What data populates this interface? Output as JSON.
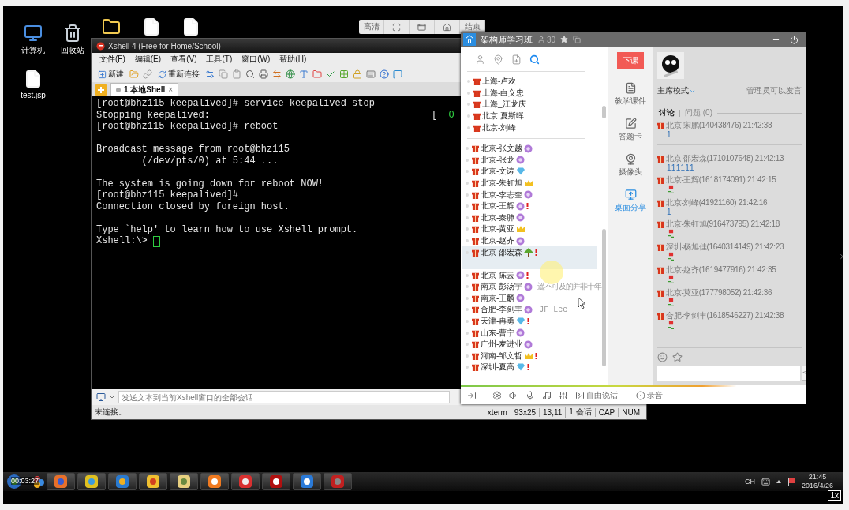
{
  "desktop": {
    "icons": [
      {
        "kind": "computer",
        "label": "计算机"
      },
      {
        "kind": "trash",
        "label": "回收站"
      },
      {
        "kind": "folder"
      },
      {
        "kind": "file"
      },
      {
        "kind": "file"
      },
      {
        "kind": "file",
        "label": "test.jsp"
      }
    ]
  },
  "floating_toolbar": {
    "items": [
      {
        "kind": "text",
        "label": "高清"
      },
      {
        "kind": "select"
      },
      {
        "kind": "window"
      },
      {
        "kind": "home"
      },
      {
        "kind": "text",
        "label": "结束"
      }
    ]
  },
  "xshell": {
    "title": "Xshell 4 (Free for Home/School)",
    "menu": [
      "文件(F)",
      "编辑(E)",
      "查看(V)",
      "工具(T)",
      "窗口(W)",
      "帮助(H)"
    ],
    "toolbar": [
      {
        "kind": "new",
        "label": "新建"
      },
      {
        "kind": "open"
      },
      {
        "kind": "link"
      },
      {
        "kind": "reconnect",
        "label": "重新连接"
      },
      {
        "kind": "props"
      },
      {
        "kind": "copy"
      },
      {
        "kind": "paste"
      },
      {
        "kind": "find"
      },
      {
        "kind": "print"
      },
      {
        "kind": "transfer"
      },
      {
        "kind": "globe"
      },
      {
        "kind": "font"
      },
      {
        "kind": "xftp"
      },
      {
        "kind": "check"
      },
      {
        "kind": "grid"
      },
      {
        "kind": "lock"
      },
      {
        "kind": "keyboard"
      },
      {
        "kind": "help"
      },
      {
        "kind": "chat"
      }
    ],
    "tab": {
      "label": "1 本地Shell",
      "close": "×"
    },
    "terminal": [
      {
        "text": "[root@bhz115 keepalived]# service keepalived stop"
      },
      {
        "text": "Stopping keepalived:",
        "bracket": "[",
        "ok": "O"
      },
      {
        "text": "[root@bhz115 keepalived]# reboot"
      },
      {
        "text": "Broadcast message from root@bhz115",
        "gap_before": true
      },
      {
        "text": "        (/dev/pts/0) at 5:44 ..."
      },
      {
        "text": "The system is going down for reboot NOW!",
        "gap_before": true
      },
      {
        "text": "[root@bhz115 keepalived]#"
      },
      {
        "text": "Connection closed by foreign host."
      },
      {
        "text": "Type `help' to learn how to use Xshell prompt.",
        "gap_before": true
      },
      {
        "text": "Xshell:\\> ",
        "cursor": true
      }
    ],
    "send_bar": {
      "placeholder": "发送文本到当前Xshell窗口的全部会话"
    },
    "status_bar": {
      "text": "未连接。",
      "fields": [
        "xterm",
        "93x25",
        "13,11",
        "1 会话",
        "CAP",
        "NUM"
      ]
    }
  },
  "classroom": {
    "title": "架构师学习班",
    "count": "30",
    "list_tools": [
      {
        "kind": "user",
        "selected": false
      },
      {
        "kind": "pin",
        "selected": false
      },
      {
        "kind": "note",
        "selected": false
      },
      {
        "kind": "search",
        "selected": true
      }
    ],
    "teachers": [
      {
        "name": "上海-卢欢"
      },
      {
        "name": "上海-白义忠"
      },
      {
        "name": "上海_江龙庆"
      },
      {
        "name": "北京 夏斯晖"
      },
      {
        "name": "北京-刘峰"
      }
    ],
    "students": [
      {
        "name": "北京-张文越",
        "badge": {
          "kind": "level"
        },
        "alert": false,
        "selected": false
      },
      {
        "name": "北京-张龙",
        "badge": {
          "kind": "level"
        },
        "alert": false,
        "selected": false
      },
      {
        "name": "北京-文涛",
        "badge": {
          "kind": "diamond"
        },
        "alert": false,
        "selected": false
      },
      {
        "name": "北京-朱虹旭",
        "badge": {
          "kind": "crown"
        },
        "alert": false,
        "selected": false
      },
      {
        "name": "北京-李志奎",
        "badge": {
          "kind": "level"
        },
        "alert": false,
        "selected": false
      },
      {
        "name": "北京-王辉",
        "badge": {
          "kind": "level"
        },
        "alert": true,
        "selected": false
      },
      {
        "name": "北京-秦肺",
        "badge": {
          "kind": "level"
        },
        "alert": false,
        "selected": false
      },
      {
        "name": "北京-黄亚",
        "badge": {
          "kind": "crown"
        },
        "alert": false,
        "selected": false
      },
      {
        "name": "北京-赵齐",
        "badge": {
          "kind": "level"
        },
        "alert": false,
        "selected": false
      },
      {
        "name": "北京-邵宏森",
        "badge": {
          "kind": "tree"
        },
        "alert": true,
        "selected": true
      },
      {
        "name": "北京-陈云",
        "badge": {
          "kind": "level"
        },
        "alert": true,
        "selected": false
      },
      {
        "name": "南京-彭汤宇",
        "badge": {
          "kind": "level"
        },
        "alert": false,
        "selected": false,
        "signature": "遥不可及的并非十年"
      },
      {
        "name": "南京-王麟",
        "badge": {
          "kind": "level"
        },
        "alert": false,
        "selected": false
      },
      {
        "name": "合肥-李剑丰",
        "badge": {
          "kind": "level"
        },
        "alert": false,
        "selected": false,
        "signature": "JF Lee"
      },
      {
        "name": "天津-冉勇",
        "badge": {
          "kind": "diamond"
        },
        "alert": true,
        "selected": false
      },
      {
        "name": "山东-曹宁",
        "badge": {
          "kind": "level"
        },
        "alert": false,
        "selected": false
      },
      {
        "name": "广州-麦进业",
        "badge": {
          "kind": "level"
        },
        "alert": false,
        "selected": false
      },
      {
        "name": "河南-邹文哲",
        "badge": {
          "kind": "crown"
        },
        "alert": true,
        "selected": false
      },
      {
        "name": "深圳-夏高",
        "badge": {
          "kind": "diamond"
        },
        "alert": true,
        "selected": false
      }
    ],
    "end_class": "下课",
    "tools": [
      {
        "kind": "courseware",
        "label": "教学课件",
        "selected": false
      },
      {
        "kind": "quiz",
        "label": "答题卡",
        "selected": false
      },
      {
        "kind": "camera",
        "label": "摄像头",
        "selected": false
      },
      {
        "kind": "share",
        "label": "桌面分享",
        "selected": true
      }
    ],
    "chat": {
      "mode": "主席模式",
      "permission": "管理员可以发言",
      "tabs": [
        {
          "label": "讨论",
          "selected": true
        },
        {
          "label": "问题 (0)",
          "selected": false
        }
      ],
      "pinned": {
        "sender": "北京-宋鹏(140438476) 21:42:38",
        "kind": "text",
        "text": "1"
      },
      "messages": [
        {
          "sender": "北京-邵宏森(1710107648) 21:42:13",
          "kind": "text",
          "text": "111111"
        },
        {
          "sender": "北京-王辉(1618174091) 21:42:15",
          "kind": "flower"
        },
        {
          "sender": "北京-刘峰(41921160) 21:42:16",
          "kind": "text",
          "text": "1"
        },
        {
          "sender": "北京-朱虹旭(916473795) 21:42:18",
          "kind": "flower"
        },
        {
          "sender": "深圳-杨旭佳(1640314149) 21:42:23",
          "kind": "flower"
        },
        {
          "sender": "北京-赵齐(1619477916) 21:42:35",
          "kind": "flower"
        },
        {
          "sender": "北京-莫亚(177798052) 21:42:36",
          "kind": "flower"
        },
        {
          "sender": "合肥-李剑丰(1618546227) 21:42:38",
          "kind": "flower"
        }
      ]
    },
    "bottom_bar": [
      {
        "kind": "exit"
      },
      {
        "kind": "settings"
      },
      {
        "kind": "speaker"
      },
      {
        "kind": "mic"
      },
      {
        "kind": "music"
      },
      {
        "kind": "mixer"
      },
      {
        "kind": "free-talk",
        "label": "自由说话"
      },
      {
        "kind": "record",
        "label": "录音"
      }
    ]
  },
  "taskbar": {
    "timer": "00:03:27",
    "apps": [
      {
        "kind": "browser"
      },
      {
        "kind": "pinwheel"
      },
      {
        "kind": "window"
      },
      {
        "kind": "mascot"
      },
      {
        "kind": "folder"
      },
      {
        "kind": "orange"
      },
      {
        "kind": "swirl"
      },
      {
        "kind": "pdf"
      },
      {
        "kind": "writer"
      },
      {
        "kind": "recorder"
      }
    ],
    "tray": {
      "lang": "CH",
      "time": "21:45",
      "date": "2016/4/26"
    }
  },
  "zoom_badge": "1x"
}
